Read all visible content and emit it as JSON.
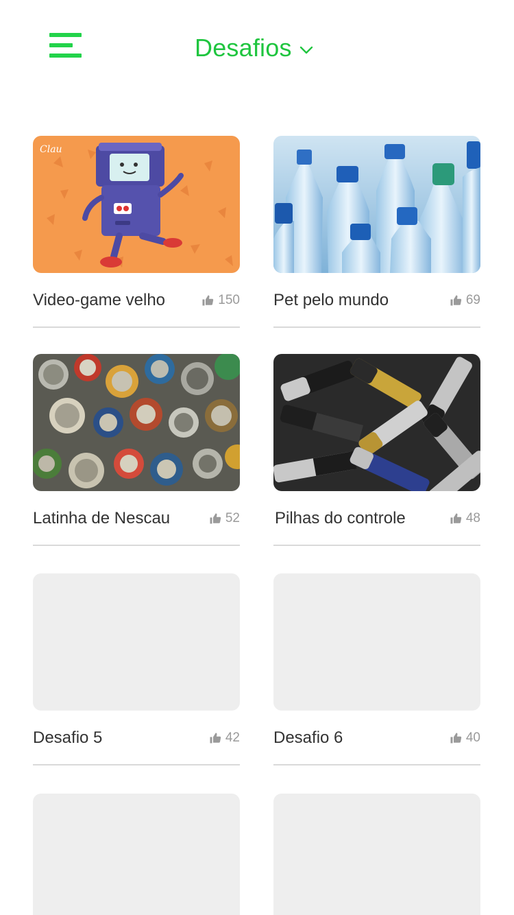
{
  "colors": {
    "accent": "#1fc53f",
    "menu_green": "#22d34a",
    "placeholder": "#eeeeee",
    "divider": "#d9d9d9",
    "like_gray": "#9a9a9a"
  },
  "header": {
    "menu_icon": "hamburger-menu-icon",
    "title": "Desafios",
    "dropdown_icon": "chevron-down-icon"
  },
  "cards": [
    {
      "title": "Video-game velho",
      "likes": "150",
      "image": "retro-arcade-robot-illustration",
      "like_icon": "thumbs-up-icon"
    },
    {
      "title": "Pet pelo mundo",
      "likes": "69",
      "image": "plastic-pet-bottles-photo",
      "like_icon": "thumbs-up-icon"
    },
    {
      "title": "Latinha de Nescau",
      "likes": "52",
      "image": "pile-of-tin-cans-photo",
      "like_icon": "thumbs-up-icon"
    },
    {
      "title": "Pilhas do controle",
      "likes": "48",
      "image": "pile-of-batteries-photo",
      "like_icon": "thumbs-up-icon"
    },
    {
      "title": "Desafio 5",
      "likes": "42",
      "image": "placeholder",
      "like_icon": "thumbs-up-icon"
    },
    {
      "title": "Desafio 6",
      "likes": "40",
      "image": "placeholder",
      "like_icon": "thumbs-up-icon"
    },
    {
      "title": "",
      "likes": "",
      "image": "placeholder"
    },
    {
      "title": "",
      "likes": "",
      "image": "placeholder"
    }
  ]
}
